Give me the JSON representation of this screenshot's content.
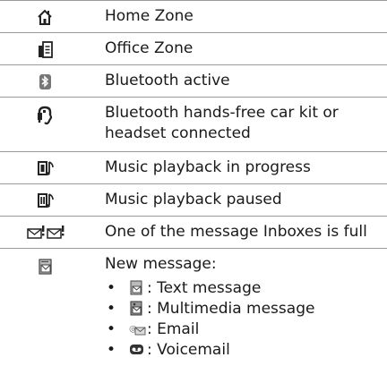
{
  "rows": [
    {
      "icon": "home-zone-icon",
      "label": "Home Zone"
    },
    {
      "icon": "office-zone-icon",
      "label": "Office Zone"
    },
    {
      "icon": "bluetooth-icon",
      "label": "Bluetooth active"
    },
    {
      "icon": "car-kit-headset-icon",
      "label_line1": "Bluetooth hands-free car kit or",
      "label_line2": "headset connected"
    },
    {
      "icon": "music-playing-icon",
      "label": "Music playback in progress"
    },
    {
      "icon": "music-paused-icon",
      "label": "Music playback paused"
    },
    {
      "icon": "inbox-full-icon",
      "label": "One of the message Inboxes is full"
    },
    {
      "icon": "new-message-icon",
      "label": "New message:"
    }
  ],
  "new_message_items": [
    {
      "icon": "text-message-icon",
      "bullet": "•",
      "label": ": Text message"
    },
    {
      "icon": "multimedia-message-icon",
      "bullet": "•",
      "label": ": Multimedia message"
    },
    {
      "icon": "email-icon",
      "bullet": "•",
      "label": ": Email"
    },
    {
      "icon": "voicemail-icon",
      "bullet": "•",
      "label": ": Voicemail"
    }
  ]
}
